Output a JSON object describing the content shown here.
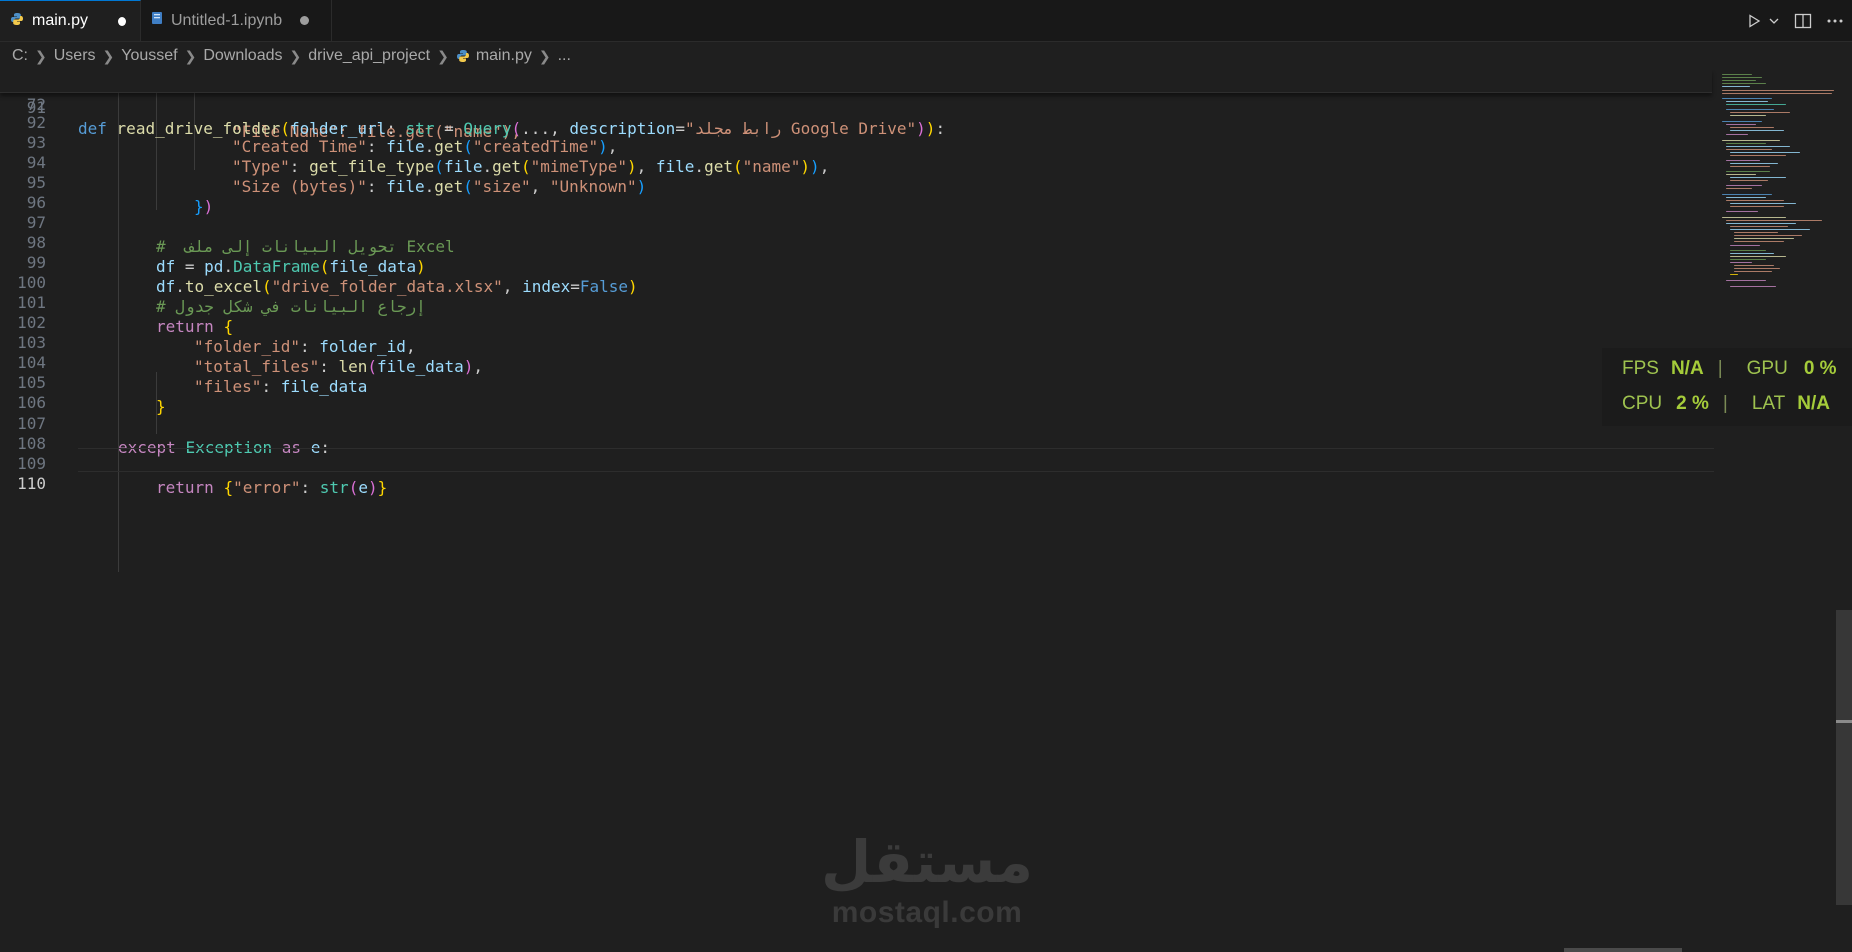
{
  "colors": {
    "background": "#1f1f1f",
    "tabbar": "#181818",
    "accent": "#0078d4",
    "perf_text": "#a5cc3a"
  },
  "tabs": [
    {
      "label": "main.py",
      "icon": "python-file-icon",
      "modified": true,
      "active": true
    },
    {
      "label": "Untitled-1.ipynb",
      "icon": "notebook-file-icon",
      "modified": true,
      "active": false
    }
  ],
  "tab_actions": [
    "run-icon",
    "chevron-down-icon",
    "split-editor-icon",
    "more-icon"
  ],
  "breadcrumb": {
    "items": [
      "C:",
      "Users",
      "Youssef",
      "Downloads",
      "drive_api_project",
      "main.py",
      "..."
    ]
  },
  "editor": {
    "sticky_line": {
      "number": "72"
    },
    "partial_line": {
      "number": "91"
    },
    "line_numbers": [
      "92",
      "93",
      "94",
      "95",
      "96",
      "97",
      "98",
      "99",
      "100",
      "101",
      "102",
      "103",
      "104",
      "105",
      "106",
      "107",
      "108",
      "109",
      "110"
    ],
    "current_line": "110",
    "tokens": {
      "def": "def",
      "read_drive_folder": "read_drive_folder",
      "folder_url": "folder_url",
      "str": "str",
      "Query": "Query",
      "ellipsis": "...",
      "description": "description",
      "desc_value": "\"رابط مجلد Google Drive\"",
      "partial_text": "\"File Name\": file.get(\"name\"),",
      "created_time_key": "\"Created Time\"",
      "file": "file",
      "get": "get",
      "created_time_val": "\"createdTime\"",
      "type_key": "\"Type\"",
      "get_file_type": "get_file_type",
      "mime_type": "\"mimeType\"",
      "name": "\"name\"",
      "size_key": "\"Size (bytes)\"",
      "size": "\"size\"",
      "unknown": "\"Unknown\"",
      "comment_excel": "#  تحويل البيانات إلى ملف Excel",
      "df": "df",
      "pd": "pd",
      "DataFrame": "DataFrame",
      "file_data": "file_data",
      "to_excel": "to_excel",
      "xlsx": "\"drive_folder_data.xlsx\"",
      "index": "index",
      "False": "False",
      "comment_return": "# إرجاع البيانات في شكل جدول",
      "return": "return",
      "folder_id_key": "\"folder_id\"",
      "folder_id": "folder_id",
      "total_files_key": "\"total_files\"",
      "len": "len",
      "files_key": "\"files\"",
      "except": "except",
      "Exception": "Exception",
      "as": "as",
      "e": "e",
      "error_key": "\"error\""
    }
  },
  "perf_overlay": {
    "fps_label": "FPS",
    "fps_value": "N/A",
    "gpu_label": "GPU",
    "gpu_value": "0 %",
    "cpu_label": "CPU",
    "cpu_value": "2 %",
    "lat_label": "LAT",
    "lat_value": "N/A"
  },
  "watermark": {
    "text": "mostaql.com"
  }
}
